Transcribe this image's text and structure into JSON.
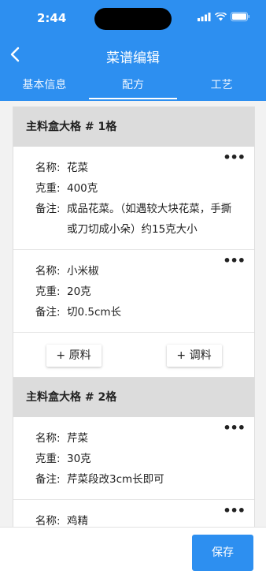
{
  "status": {
    "time": "2:44"
  },
  "nav": {
    "title": "菜谱编辑"
  },
  "tabs": [
    "基本信息",
    "配方",
    "工艺"
  ],
  "labels": {
    "name": "名称:",
    "weight": "克重:",
    "note": "备注:"
  },
  "more_glyph": "•••",
  "cards": [
    {
      "header": "主料盒大格 # 1格",
      "items": [
        {
          "name": "花菜",
          "weight": "400克",
          "note": "成品花菜。（如遇较大块花菜，手撕或刀切成小朵）约15克大小"
        },
        {
          "name": "小米椒",
          "weight": "20克",
          "note": "切0.5cm长"
        }
      ],
      "buttons": [
        "+ 原料",
        "+ 调料"
      ]
    },
    {
      "header": "主料盒大格 # 2格",
      "items": [
        {
          "name": "芹菜",
          "weight": "30克",
          "note": "芹菜段改3cm长即可"
        },
        {
          "name": "鸡精"
        }
      ]
    }
  ],
  "footer": {
    "save_label": "保存"
  },
  "colors": {
    "primary": "#2d8ff0",
    "card_header": "#dcdcdc"
  }
}
